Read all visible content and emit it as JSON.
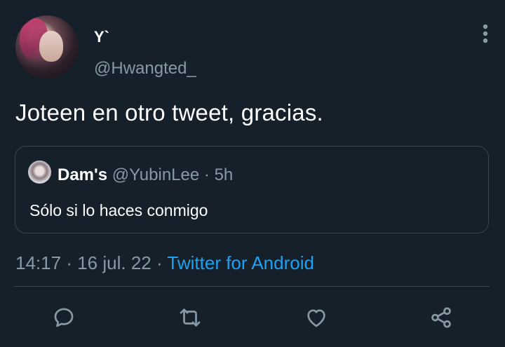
{
  "author": {
    "display_name": "Y`",
    "handle": "@Hwangted_"
  },
  "tweet": {
    "text": "Joteen en otro tweet, gracias."
  },
  "quoted_tweet": {
    "display_name": "Dam's",
    "handle": "@YubinLee",
    "separator": "·",
    "age": "5h",
    "text": "Sólo si lo haces conmigo"
  },
  "meta": {
    "time": "14:17",
    "sep1": "·",
    "date": "16 jul. 22",
    "sep2": "·",
    "source": "Twitter for Android"
  },
  "actions": [
    {
      "name": "reply",
      "icon": "reply-icon"
    },
    {
      "name": "retweet",
      "icon": "retweet-icon"
    },
    {
      "name": "like",
      "icon": "heart-icon"
    },
    {
      "name": "share",
      "icon": "share-icon"
    }
  ],
  "colors": {
    "background": "#15202b",
    "secondary_text": "#8899a6",
    "link": "#1da1f2",
    "border": "#38444d"
  }
}
